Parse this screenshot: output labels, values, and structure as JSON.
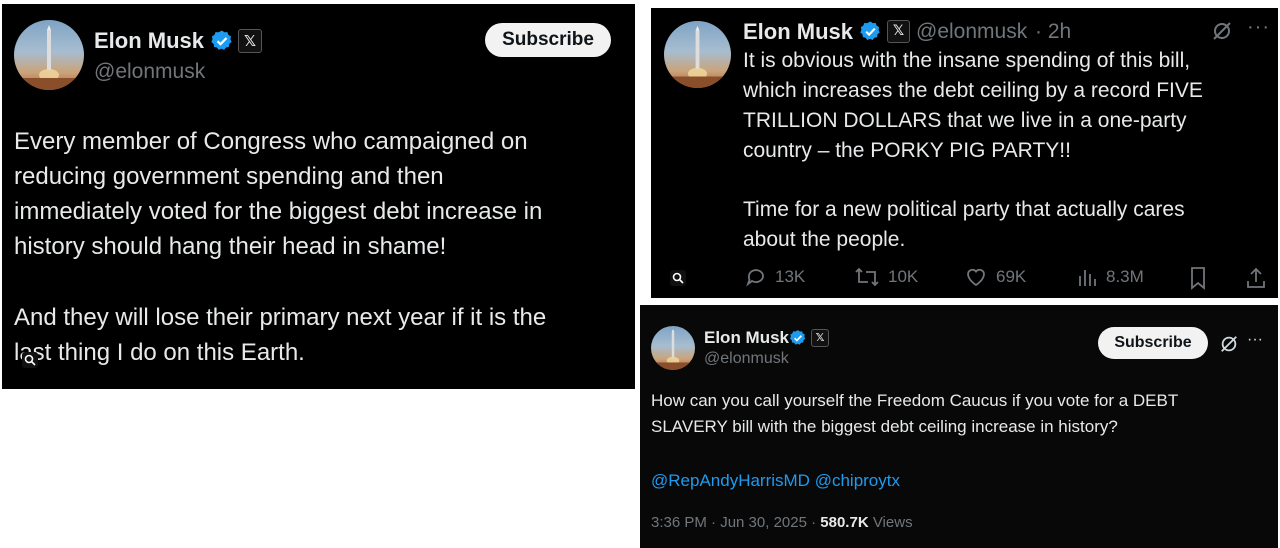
{
  "tweet1": {
    "name": "Elon Musk",
    "handle": "@elonmusk",
    "subscribe_label": "Subscribe",
    "lines": [
      "Every member of Congress who campaigned on",
      "reducing government spending and then",
      "immediately voted for the biggest debt increase in",
      "history should hang their head in shame!",
      "",
      "And they will lose their primary next year if it is the",
      "last thing I do on this Earth."
    ]
  },
  "tweet2": {
    "name": "Elon Musk",
    "handle": "@elonmusk",
    "time": "· 2h",
    "lines": [
      "It is obvious with the insane spending of this bill,",
      "which increases the debt ceiling by a record FIVE",
      "TRILLION DOLLARS that we live in a one-party",
      "country – the PORKY PIG PARTY!!",
      "",
      "Time for a new political party that actually cares",
      "about the people."
    ],
    "actions": {
      "replies": "13K",
      "reposts": "10K",
      "likes": "69K",
      "views": "8.3M"
    }
  },
  "tweet3": {
    "name": "Elon Musk",
    "handle": "@elonmusk",
    "subscribe_label": "Subscribe",
    "lines": [
      "How can you call yourself the Freedom Caucus if you vote for a DEBT",
      "SLAVERY bill with the biggest debt ceiling increase in history?"
    ],
    "mention1": "@RepAndyHarrisMD",
    "mention2": "@chiproytx",
    "timestamp": "3:36 PM · Jun 30, 2025 ·",
    "views_count": "580.7K",
    "views_label": "Views"
  },
  "colors": {
    "verified_blue": "#1d9bf0",
    "muted_gray": "#71767b",
    "text": "#e7e9ea"
  },
  "icons": [
    "verified-badge-icon",
    "x-logo-icon",
    "reply-icon",
    "repost-icon",
    "like-icon",
    "views-icon",
    "bookmark-icon",
    "share-icon",
    "grok-icon",
    "more-icon",
    "image-search-icon"
  ]
}
